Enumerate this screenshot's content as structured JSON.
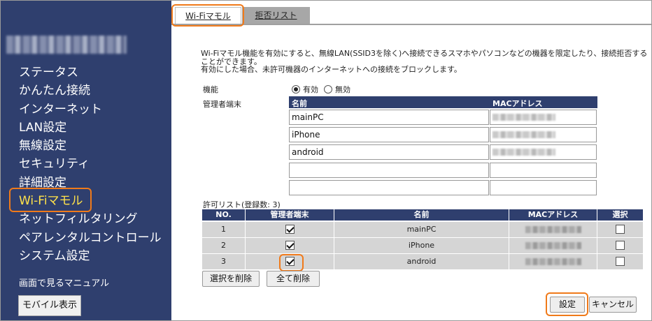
{
  "sidebar": {
    "nav": [
      {
        "label": "ステータス"
      },
      {
        "label": "かんたん接続"
      },
      {
        "label": "インターネット"
      },
      {
        "label": "LAN設定"
      },
      {
        "label": "無線設定"
      },
      {
        "label": "セキュリティ"
      },
      {
        "label": "詳細設定"
      },
      {
        "label": "Wi-Fiマモル"
      },
      {
        "label": "ネットフィルタリング"
      },
      {
        "label": "ペアレンタルコントロール"
      },
      {
        "label": "システム設定"
      }
    ],
    "manual_link": "画面で見るマニュアル",
    "mobile_button": "モバイル表示"
  },
  "tabs": [
    {
      "label": "Wi-Fiマモル"
    },
    {
      "label": "拒否リスト"
    }
  ],
  "description": {
    "line1": "Wi-Fiマモル機能を有効にすると、無線LAN(SSID3を除く)へ接続できるスマホやパソコンなどの機器を限定したり、接続拒否することができます。",
    "line2": "有効にした場合、未許可機器のインターネットへの接続をブロックします。"
  },
  "form": {
    "function_label": "機能",
    "enable_label": "有効",
    "disable_label": "無効",
    "admin_label": "管理者端末",
    "admin_col_name": "名前",
    "admin_col_mac": "MACアドレス",
    "admin_rows": [
      {
        "name": "mainPC"
      },
      {
        "name": "iPhone"
      },
      {
        "name": "android"
      },
      {
        "name": ""
      },
      {
        "name": ""
      }
    ]
  },
  "allow_list": {
    "caption": "許可リスト(登録数: 3)",
    "headers": {
      "no": "NO.",
      "admin": "管理者端末",
      "name": "名前",
      "mac": "MACアドレス",
      "select": "選択"
    },
    "rows": [
      {
        "no": "1",
        "name": "mainPC"
      },
      {
        "no": "2",
        "name": "iPhone"
      },
      {
        "no": "3",
        "name": "android"
      }
    ]
  },
  "buttons": {
    "delete_selected": "選択を削除",
    "delete_all": "全て削除",
    "apply": "設定",
    "cancel": "キャンセル"
  },
  "colors": {
    "sidebar_bg": "#2f3f6e",
    "active_nav": "#ffe24a",
    "highlight": "#f07a1a",
    "table_header": "#2f3f6e"
  }
}
